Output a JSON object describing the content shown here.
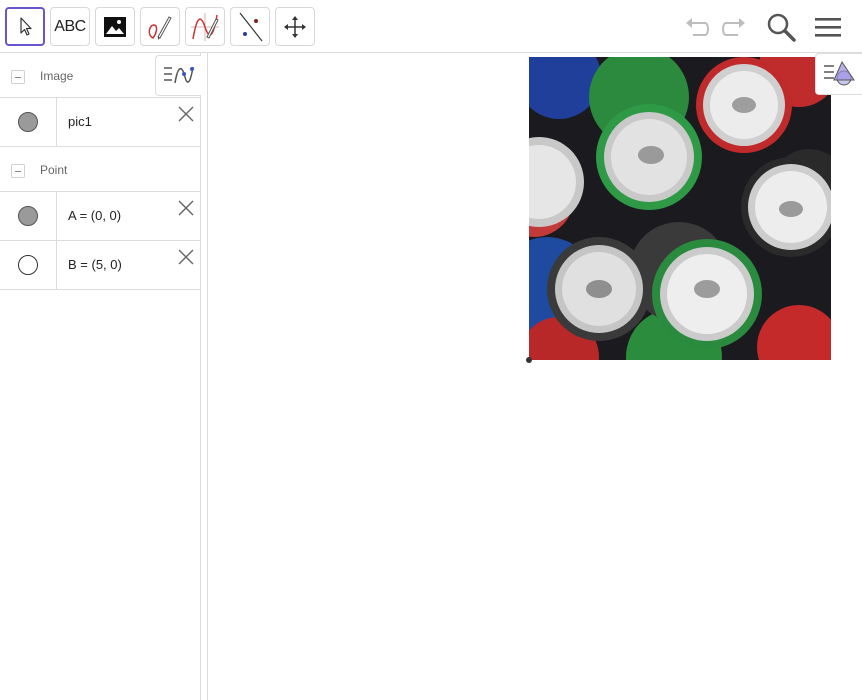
{
  "toolbar": {
    "tools": [
      {
        "name": "move-tool",
        "label": "",
        "selected": true
      },
      {
        "name": "text-tool",
        "label": "ABC",
        "selected": false
      },
      {
        "name": "image-tool",
        "label": "",
        "selected": false
      },
      {
        "name": "pen-tool",
        "label": "",
        "selected": false
      },
      {
        "name": "function-tool",
        "label": "",
        "selected": false
      },
      {
        "name": "line-tool",
        "label": "",
        "selected": false
      },
      {
        "name": "move-graphics-tool",
        "label": "",
        "selected": false
      }
    ],
    "right_icons": [
      "undo-icon",
      "redo-icon",
      "search-icon",
      "menu-icon"
    ]
  },
  "algebra": {
    "groups": [
      {
        "label": "Image",
        "rows": [
          {
            "text": "pic1",
            "visible": true
          }
        ]
      },
      {
        "label": "Point",
        "rows": [
          {
            "text": "A = (0, 0)",
            "visible": true
          },
          {
            "text": "B = (5, 0)",
            "visible": false
          }
        ]
      }
    ]
  },
  "colors": {
    "selected_border": "#6557d2",
    "marble_on": "#9a9a9a",
    "divider": "#dcdcdc",
    "undo_disabled": "#bdbdbd"
  }
}
